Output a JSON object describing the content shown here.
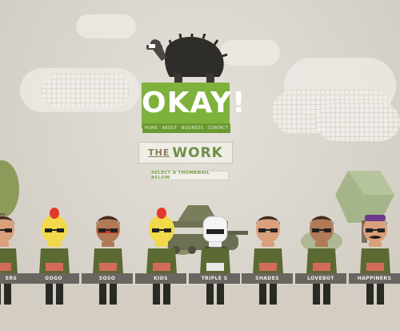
{
  "site": {
    "logo_text": "OKAY!",
    "nav_items": [
      "HOME",
      "ABOUT",
      "BUSINESS",
      "CONTACT"
    ],
    "the_work": {
      "prefix": "THE",
      "word": "WORK"
    },
    "select_prompt": "SELECT A THUMBNAIL BELOW"
  },
  "thumbnails": [
    {
      "label": "ERS"
    },
    {
      "label": "GOGO"
    },
    {
      "label": "SOSO"
    },
    {
      "label": "KIDS"
    },
    {
      "label": "TRIPLE S"
    },
    {
      "label": "SHADES"
    },
    {
      "label": "LOVEBOT"
    },
    {
      "label": "HAPPINERS"
    }
  ],
  "colors": {
    "brand_green": "#7fb13d",
    "label_bar": "#6a6560",
    "background": "#dcd7cf"
  },
  "icons": [
    "tortoise-mascot-icon",
    "tree-icon",
    "cloud-icon",
    "tank-icon",
    "character-icon"
  ]
}
